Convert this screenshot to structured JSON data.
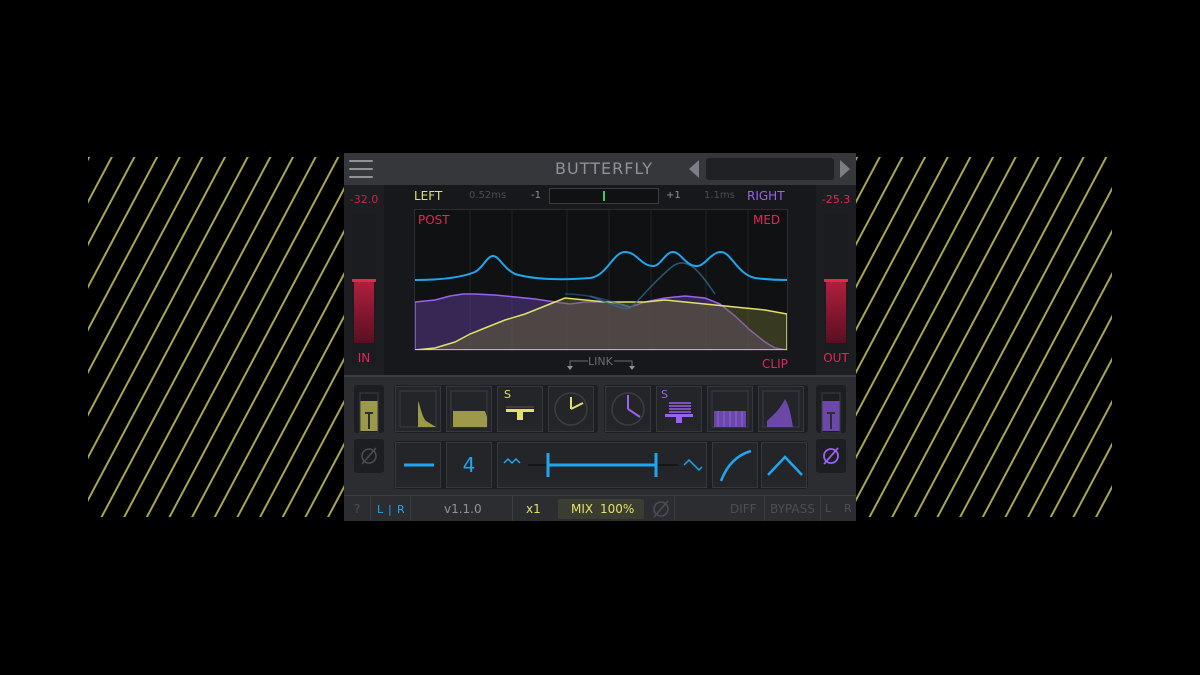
{
  "app": {
    "title": "BUTTERFLY",
    "preset_name": ""
  },
  "meters": {
    "input": {
      "value": "-32.0",
      "label": "IN"
    },
    "output": {
      "value": "-25.3",
      "label": "OUT"
    }
  },
  "graph": {
    "left_label": "LEFT",
    "left_delay": "0.52ms",
    "corr_min": "-1",
    "corr_max": "+1",
    "right_delay": "1.1ms",
    "right_label": "RIGHT",
    "post_label": "POST",
    "med_label": "MED",
    "link_label": "LINK",
    "clip_label": "CLIP"
  },
  "modules": {
    "solo_left": "S",
    "solo_right": "S"
  },
  "controls": {
    "band_count": "4"
  },
  "footer": {
    "help": "?",
    "lr_left": "L",
    "lr_sep": "|",
    "lr_right": "R",
    "version": "v1.1.0",
    "oversample": "x1",
    "mix_label": "MIX",
    "mix_value": "100%",
    "diff": "DIFF",
    "bypass": "BYPASS",
    "ch_l": "L",
    "ch_r": "R"
  },
  "colors": {
    "yellow": "#e3e06a",
    "purple": "#9a62f0",
    "cyan": "#1fa6ee",
    "red": "#e8245a",
    "bg": "#25272b"
  }
}
